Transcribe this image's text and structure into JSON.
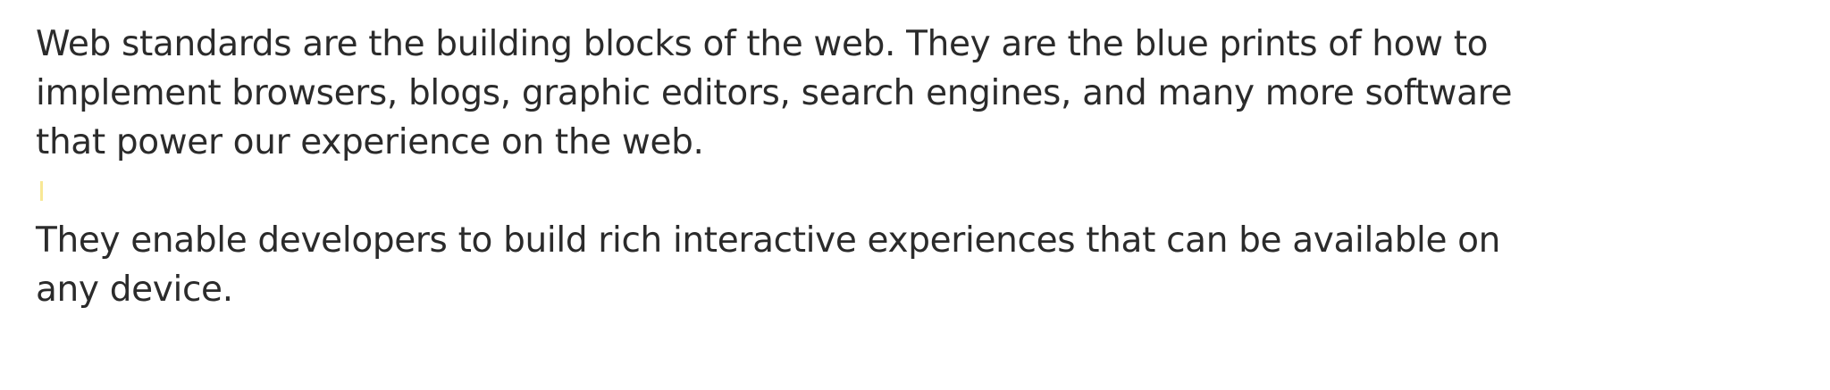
{
  "document": {
    "paragraphs": [
      {
        "lines": [
          "Web standards are the building blocks of the web. They are the blue prints of how to",
          "implement browsers, blogs, graphic editors, search engines, and many more software",
          "that power our experience on the web."
        ]
      },
      {
        "lines": [
          "They enable developers to build rich interactive experiences that can be available on",
          "any device."
        ]
      }
    ]
  }
}
